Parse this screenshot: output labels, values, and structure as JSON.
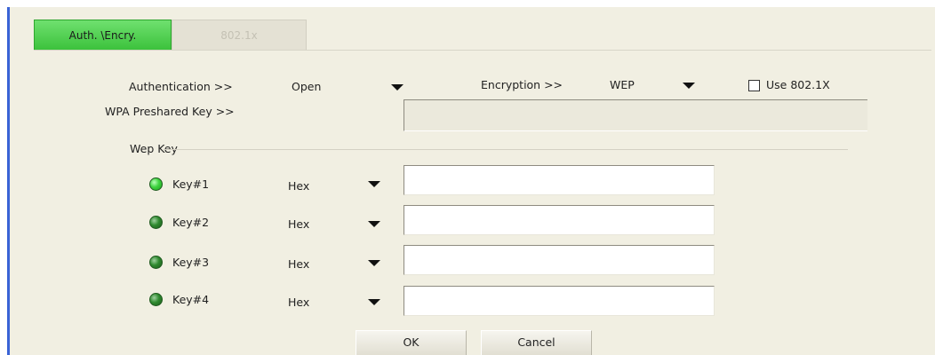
{
  "tabs": [
    {
      "label": "Auth. \\Encry.",
      "active": true
    },
    {
      "label": "802.1x",
      "active": false
    }
  ],
  "authentication": {
    "label": "Authentication >>",
    "value": "Open"
  },
  "encryption": {
    "label": "Encryption >>",
    "value": "WEP"
  },
  "use8021x": {
    "label": "Use 802.1X",
    "checked": false
  },
  "wpa": {
    "label": "WPA Preshared Key >>",
    "value": ""
  },
  "wep": {
    "group_label": "Wep Key",
    "keys": [
      {
        "label": "Key#1",
        "format": "Hex",
        "selected": true,
        "value": ""
      },
      {
        "label": "Key#2",
        "format": "Hex",
        "selected": false,
        "value": ""
      },
      {
        "label": "Key#3",
        "format": "Hex",
        "selected": false,
        "value": ""
      },
      {
        "label": "Key#4",
        "format": "Hex",
        "selected": false,
        "value": ""
      }
    ]
  },
  "buttons": {
    "ok": "OK",
    "cancel": "Cancel"
  },
  "colors": {
    "accent_green": "#3cc23c",
    "panel_bg": "#f1efe2",
    "left_border": "#3a63d6"
  }
}
